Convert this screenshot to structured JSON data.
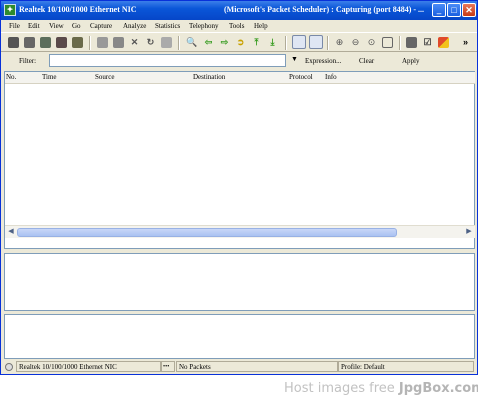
{
  "window": {
    "title_left": "Realtek 10/100/1000 Ethernet NIC",
    "title_right": "(Microsoft's Packet Scheduler) : Capturing (port 8484) - ...",
    "min_symbol": "_",
    "max_symbol": "□",
    "close_symbol": "✕"
  },
  "menu": [
    "File",
    "Edit",
    "View",
    "Go",
    "Capture",
    "Analyze",
    "Statistics",
    "Telephony",
    "Tools",
    "Help"
  ],
  "toolbar": {
    "more": "»"
  },
  "filter": {
    "label": "Filter:",
    "value": "",
    "dropdown_symbol": "▼",
    "expression_label": "Expression...",
    "clear_label": "Clear",
    "apply_label": "Apply"
  },
  "packet_list": {
    "columns": [
      "No.",
      "Time",
      "Source",
      "Destination",
      "Protocol",
      "Info"
    ],
    "scroll_left": "◀",
    "scroll_right": "▶"
  },
  "status": {
    "interface": "Realtek 10/100/1000 Ethernet NIC",
    "dots": "•••",
    "packets": "No Packets",
    "profile": "Profile: Default"
  },
  "watermark": {
    "prefix": "Host images free ",
    "brand": "JpgBox.com"
  }
}
